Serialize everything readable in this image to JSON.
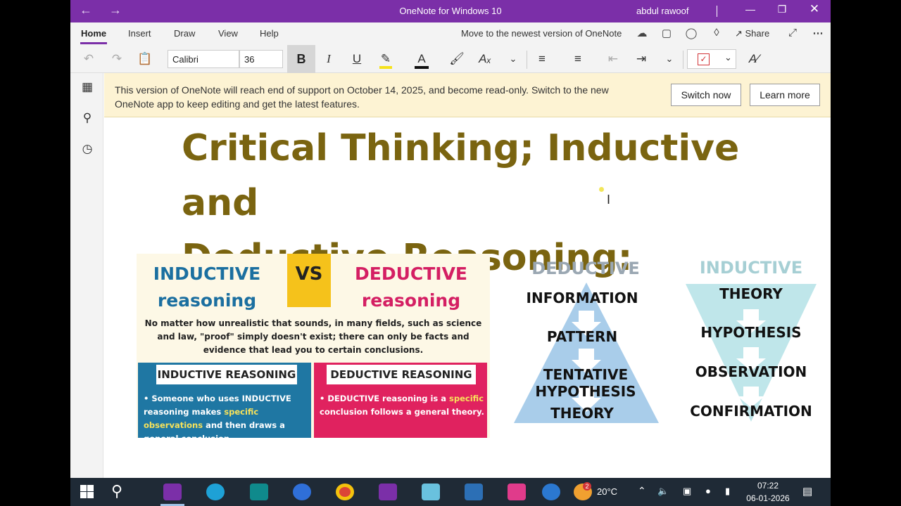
{
  "window": {
    "title": "OneNote for Windows 10",
    "user": "abdul rawoof"
  },
  "menu": {
    "tabs": [
      "Home",
      "Insert",
      "Draw",
      "View",
      "Help"
    ],
    "move_link": "Move to the newest version of OneNote",
    "share_label": "Share"
  },
  "toolbar": {
    "font_name": "Calibri",
    "font_size": "36",
    "bold": "B",
    "italic": "I",
    "underline": "U",
    "font_color_glyph": "A"
  },
  "banner": {
    "message": "This version of OneNote will reach end of support on October 14, 2025, and become read-only. Switch to the new OneNote app to keep editing and get the latest features.",
    "switch_now": "Switch now",
    "learn_more": "Learn more"
  },
  "page": {
    "title_line1": "Critical Thinking; Inductive and",
    "title_line2": "Deductive Reasoning:"
  },
  "infographic_vs": {
    "inductive_title_1": "INDUCTIVE",
    "inductive_title_2": "reasoning",
    "vs": "VS",
    "deductive_title_1": "DEDUCTIVE",
    "deductive_title_2": "reasoning",
    "description": "No matter how unrealistic that sounds, in many fields, such as science and law, \"proof\" simply doesn't exist; there can only be facts and evidence that lead you to certain conclusions.",
    "inductive_panel_title": "INDUCTIVE REASONING",
    "inductive_panel_text_a": "• Someone who uses INDUCTIVE reasoning makes ",
    "inductive_panel_text_hl": "specific observations",
    "inductive_panel_text_b": " and then draws a general conclusion.",
    "deductive_panel_title": "DEDUCTIVE REASONING",
    "deductive_panel_text_a": "• DEDUCTIVE reasoning is a ",
    "deductive_panel_text_hl": "specific",
    "deductive_panel_text_b": " conclusion follows a general theory."
  },
  "deductive_triangle": {
    "label": "DEDUCTIVE",
    "items": [
      "INFORMATION",
      "PATTERN",
      "TENTATIVE HYPOTHESIS",
      "THEORY"
    ],
    "color": "#a9cdea"
  },
  "inductive_triangle": {
    "label": "INDUCTIVE",
    "items": [
      "THEORY",
      "HYPOTHESIS",
      "OBSERVATION",
      "CONFIRMATION"
    ],
    "color": "#bfe6ea"
  },
  "taskbar": {
    "weather": "20°C",
    "time": "07:22",
    "date": "06-01-2026",
    "notification_badge": "2"
  },
  "colors": {
    "accent": "#7b2fa8",
    "title_text": "#7a6410",
    "banner_bg": "#fdf3d3"
  }
}
